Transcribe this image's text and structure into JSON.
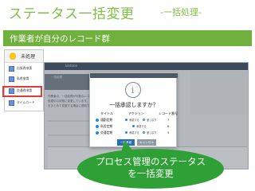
{
  "slide": {
    "title": "ステータス一括変更",
    "subtitle": "-一括処理-",
    "heading": "作業者が自分のレコード群"
  },
  "panel": {
    "title": "未処理",
    "items": [
      "出張費申請",
      "私費申請",
      "交通費申請",
      "タイムカード"
    ]
  },
  "app": {
    "top_text": "kintone",
    "dark_text": "一括処理",
    "body_lines": [
      "作業者の、一括処理が可能なレコードを",
      "処理中の状態に変更しています。ステータス",
      "をまとめて変更する場合に便利です。"
    ]
  },
  "modal": {
    "question": "一括承認しますか？",
    "headers": {
      "title": "タイトル",
      "action": "アクション",
      "count": "レコード番号"
    },
    "rows": [
      {
        "label": "通勤定期",
        "a1": "承認する",
        "a2": "差し戻す",
        "num": "7"
      },
      {
        "label": "私用定期",
        "a1": "承認する",
        "a2": "",
        "num": "6"
      },
      {
        "label": "交通定期",
        "a1": "承認する",
        "a2": "差し戻す",
        "num": "5"
      }
    ],
    "confirm_label": "一括承認",
    "cancel_label": "キャンセル"
  },
  "callout": {
    "line1": "プロセス管理のステータス",
    "line2": "を一括変更"
  }
}
